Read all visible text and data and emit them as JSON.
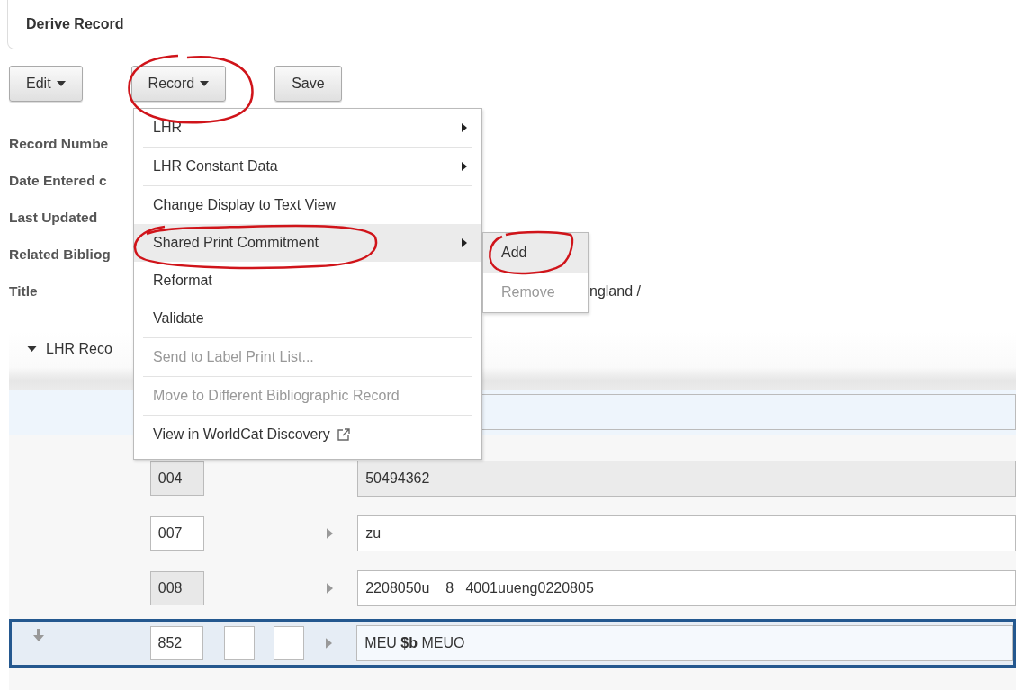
{
  "header": {
    "title": "Derive Record"
  },
  "toolbar": [
    {
      "label": "Edit",
      "dropdown": true
    },
    {
      "label": "Record",
      "dropdown": true
    },
    {
      "label": "Save",
      "dropdown": false
    }
  ],
  "fields": [
    {
      "label": "Record Numbe"
    },
    {
      "label": "Date Entered c"
    },
    {
      "label": "Last Updated"
    },
    {
      "label": "Related Bibliog"
    },
    {
      "label": "Title",
      "value": "ngland /"
    }
  ],
  "section": {
    "title": "LHR Reco",
    "expanded": true,
    "rows": [
      {
        "tag": "004",
        "tag_locked": true,
        "indicators": false,
        "expander": false,
        "value": "50494362",
        "value_locked": true,
        "selected": false
      },
      {
        "tag": "007",
        "tag_locked": false,
        "indicators": false,
        "expander": true,
        "value": "zu",
        "value_locked": false,
        "selected": false
      },
      {
        "tag": "008",
        "tag_locked": true,
        "indicators": false,
        "expander": true,
        "value": "2208050u    8   4001uueng0220805",
        "value_locked": false,
        "selected": false
      },
      {
        "tag": "852",
        "tag_locked": false,
        "indicators": true,
        "expander": true,
        "value": "MEU **$b** MEUO",
        "value_locked": false,
        "selected": true
      }
    ]
  },
  "menu": [
    {
      "label": "LHR",
      "submenu": true,
      "disabled": false,
      "highlighted": false,
      "divider_before": false,
      "external": false
    },
    {
      "label": "LHR Constant Data",
      "submenu": true,
      "disabled": false,
      "highlighted": false,
      "divider_before": true,
      "external": false
    },
    {
      "label": "Change Display to Text View",
      "submenu": false,
      "disabled": false,
      "highlighted": false,
      "divider_before": true,
      "external": false
    },
    {
      "label": "Shared Print Commitment",
      "submenu": true,
      "disabled": false,
      "highlighted": true,
      "divider_before": false,
      "external": false
    },
    {
      "label": "Reformat",
      "submenu": false,
      "disabled": false,
      "highlighted": false,
      "divider_before": false,
      "external": false
    },
    {
      "label": "Validate",
      "submenu": false,
      "disabled": false,
      "highlighted": false,
      "divider_before": false,
      "external": false
    },
    {
      "label": "Send to Label Print List...",
      "submenu": false,
      "disabled": true,
      "highlighted": false,
      "divider_before": true,
      "external": false
    },
    {
      "label": "Move to Different Bibliographic Record",
      "submenu": false,
      "disabled": true,
      "highlighted": false,
      "divider_before": true,
      "external": false
    },
    {
      "label": "View in WorldCat Discovery",
      "submenu": false,
      "disabled": false,
      "highlighted": false,
      "divider_before": true,
      "external": true
    }
  ],
  "submenu": [
    {
      "label": "Add",
      "disabled": false,
      "highlighted": true
    },
    {
      "label": "Remove",
      "disabled": true,
      "highlighted": false
    }
  ]
}
